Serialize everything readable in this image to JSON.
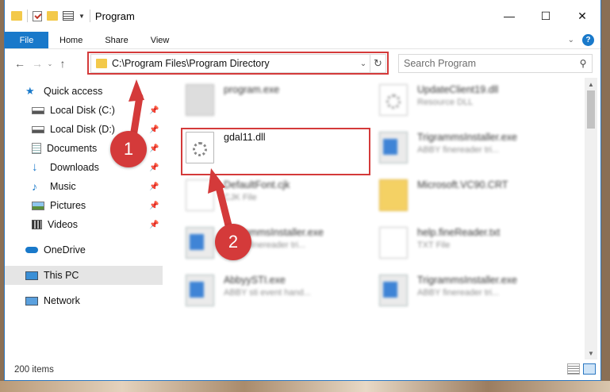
{
  "window": {
    "title": "Program"
  },
  "ribbon": {
    "file": "File",
    "tabs": [
      "Home",
      "Share",
      "View"
    ]
  },
  "nav": {
    "address": "C:\\Program Files\\Program Directory",
    "search_placeholder": "Search Program"
  },
  "sidebar": {
    "items": [
      {
        "label": "Quick access",
        "icon": "star-icon",
        "pinned": false
      },
      {
        "label": "Local Disk (C:)",
        "icon": "drive-icon",
        "pinned": true
      },
      {
        "label": "Local Disk (D:)",
        "icon": "drive-icon",
        "pinned": true
      },
      {
        "label": "Documents",
        "icon": "documents-icon",
        "pinned": true
      },
      {
        "label": "Downloads",
        "icon": "download-icon",
        "pinned": true
      },
      {
        "label": "Music",
        "icon": "music-icon",
        "pinned": true
      },
      {
        "label": "Pictures",
        "icon": "pictures-icon",
        "pinned": true
      },
      {
        "label": "Videos",
        "icon": "videos-icon",
        "pinned": true
      },
      {
        "label": "OneDrive",
        "icon": "cloud-icon",
        "pinned": false
      },
      {
        "label": "This PC",
        "icon": "computer-icon",
        "pinned": false,
        "selected": true
      },
      {
        "label": "Network",
        "icon": "network-icon",
        "pinned": false
      }
    ]
  },
  "files": [
    {
      "name": "program.exe",
      "sub": ""
    },
    {
      "name": "UpdateClient19.dll",
      "sub": "Resource DLL"
    },
    {
      "name": "gdal11.dll",
      "sub": ""
    },
    {
      "name": "TrigrammsInstaller.exe",
      "sub": "ABBY finereader tri..."
    },
    {
      "name": "DefaultFont.cjk",
      "sub": "CJK File"
    },
    {
      "name": "Microsoft.VC90.CRT",
      "sub": ""
    },
    {
      "name": "TrigrammsInstaller.exe",
      "sub": "ABBY finereader tri..."
    },
    {
      "name": "help.fineReader.txt",
      "sub": "TXT File"
    },
    {
      "name": "AbbyySTI.exe",
      "sub": "ABBY sti event hand..."
    },
    {
      "name": "TrigrammsInstaller.exe",
      "sub": "ABBY finereader tri..."
    }
  ],
  "status": {
    "count": "200 items"
  },
  "callouts": {
    "one": "1",
    "two": "2"
  },
  "colors": {
    "accent": "#1979ca",
    "highlight": "#d43a3a"
  }
}
